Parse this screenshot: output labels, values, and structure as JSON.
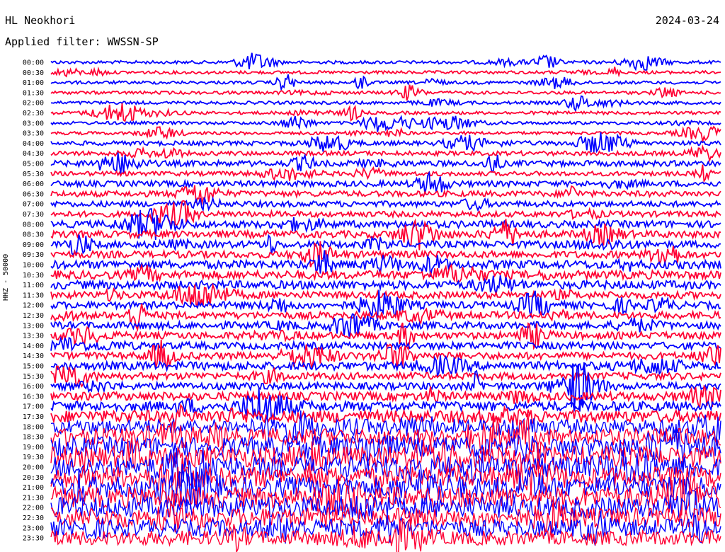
{
  "header": {
    "station": "HL Neokhori",
    "date": "2024-03-24",
    "filter": "Applied filter: WWSSN-SP"
  },
  "chart_data": {
    "type": "line",
    "title": "HL Neokhori",
    "ylabel": "HHZ - 50000",
    "row_labels": [
      "00:00",
      "00:30",
      "01:00",
      "01:30",
      "02:00",
      "02:30",
      "03:00",
      "03:30",
      "04:00",
      "04:30",
      "05:00",
      "05:30",
      "06:00",
      "06:30",
      "07:00",
      "07:30",
      "08:00",
      "08:30",
      "09:00",
      "09:30",
      "10:00",
      "10:30",
      "11:00",
      "11:30",
      "12:00",
      "12:30",
      "13:00",
      "13:30",
      "14:00",
      "14:30",
      "15:00",
      "15:30",
      "16:00",
      "16:30",
      "17:00",
      "17:30",
      "18:00",
      "18:30",
      "19:00",
      "19:30",
      "20:00",
      "20:30",
      "21:00",
      "21:30",
      "22:00",
      "22:30",
      "23:00",
      "23:30"
    ],
    "series_colors": [
      "#0000ff",
      "#ff0033"
    ],
    "trace_activity_relative": [
      1,
      1,
      1,
      1,
      1,
      1,
      1,
      1,
      2,
      2,
      3,
      2,
      3,
      3,
      3,
      3,
      4,
      4,
      4,
      4,
      5,
      5,
      5,
      4,
      4,
      4,
      4,
      4,
      4,
      4,
      5,
      4,
      4,
      5,
      6,
      8,
      10,
      12,
      14,
      15,
      15,
      15,
      15,
      15,
      15,
      14,
      12,
      10
    ]
  }
}
